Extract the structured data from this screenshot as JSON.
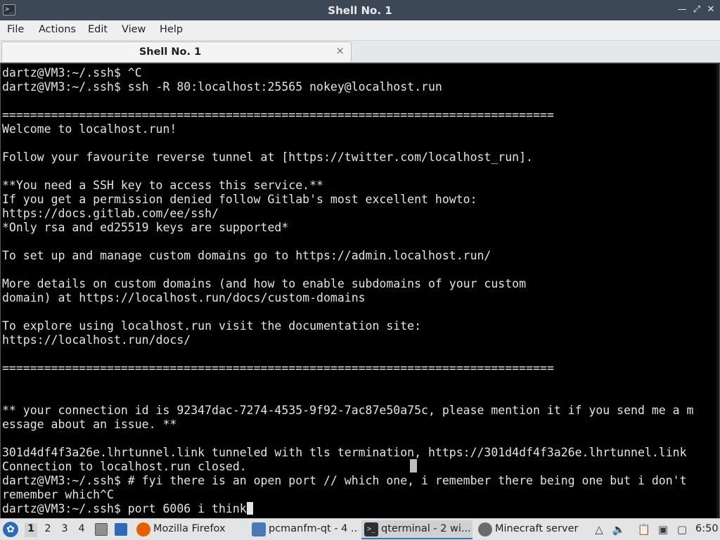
{
  "window": {
    "title": "Shell No. 1",
    "controls": [
      "minimize-icon",
      "maximize-icon",
      "close-icon"
    ]
  },
  "menubar": {
    "items": [
      "File",
      "Actions",
      "Edit",
      "View",
      "Help"
    ]
  },
  "tabs": [
    {
      "label": "Shell No. 1",
      "close": "×"
    }
  ],
  "terminal": {
    "lines": [
      "dartz@VM3:~/.ssh$ ^C",
      "dartz@VM3:~/.ssh$ ssh -R 80:localhost:25565 nokey@localhost.run",
      "",
      "===============================================================================",
      "Welcome to localhost.run!",
      "",
      "Follow your favourite reverse tunnel at [https://twitter.com/localhost_run].",
      "",
      "**You need a SSH key to access this service.**",
      "If you get a permission denied follow Gitlab's most excellent howto:",
      "https://docs.gitlab.com/ee/ssh/",
      "*Only rsa and ed25519 keys are supported*",
      "",
      "To set up and manage custom domains go to https://admin.localhost.run/",
      "",
      "More details on custom domains (and how to enable subdomains of your custom",
      "domain) at https://localhost.run/docs/custom-domains",
      "",
      "To explore using localhost.run visit the documentation site:",
      "https://localhost.run/docs/",
      "",
      "===============================================================================",
      "",
      "",
      "** your connection id is 92347dac-7274-4535-9f92-7ac87e50a75c, please mention it if you send me a m",
      "essage about an issue. **",
      "",
      "301d4df4f3a26e.lhrtunnel.link tunneled with tls termination, https://301d4df4f3a26e.lhrtunnel.link",
      "Connection to localhost.run closed.",
      "dartz@VM3:~/.ssh$ # fyi there is an open port // which one, i remember there being one but i don't",
      "remember which^C",
      "dartz@VM3:~/.ssh$ port 6006 i think"
    ]
  },
  "taskbar": {
    "workspaces": [
      "1",
      "2",
      "3",
      "4"
    ],
    "active_workspace": "1",
    "tasks": [
      {
        "label": "Mozilla Firefox",
        "icon": "firefox-icon"
      },
      {
        "label": "pcmanfm-qt - 4 ...",
        "icon": "folder-icon"
      },
      {
        "label": "qterminal - 2 wi...",
        "icon": "terminal-icon"
      },
      {
        "label": "Minecraft server",
        "icon": "minecraft-server-icon"
      }
    ],
    "clock": "6:50"
  }
}
